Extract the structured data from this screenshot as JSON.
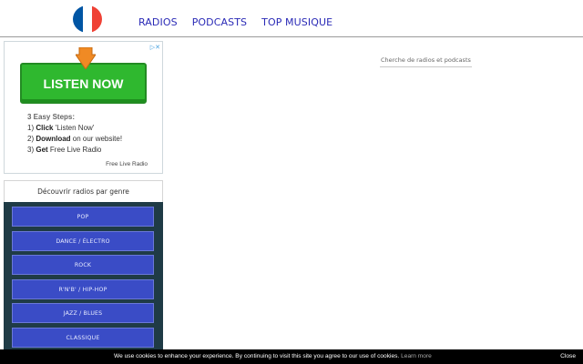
{
  "header": {
    "flag_colors": [
      "#0055a4",
      "#ffffff",
      "#ef4135"
    ],
    "nav": [
      "RADIOS",
      "PODCASTS",
      "TOP MUSIQUE"
    ],
    "link_color": "#2a2ab6"
  },
  "search": {
    "placeholder": "Cherche de radios et podcasts"
  },
  "ad": {
    "close_glyphs": "▷✕",
    "button_label": "LISTEN NOW",
    "steps_title": "3 Easy Steps:",
    "steps": [
      {
        "prefix": "1) ",
        "bold": "Click",
        "rest": " 'Listen Now'"
      },
      {
        "prefix": "2) ",
        "bold": "Download",
        "rest": " on our website!"
      },
      {
        "prefix": "3) ",
        "bold": "Get",
        "rest": " Free Live Radio"
      }
    ],
    "footer": "Free Live Radio",
    "button_color": "#2fb82f",
    "arrow_color": "#f08a24"
  },
  "genres": {
    "title": "Découvrir radios par genre",
    "items": [
      "POP",
      "DANCE / ÉLECTRO",
      "ROCK",
      "R'N'B' / HIP-HOP",
      "JAZZ / BLUES",
      "CLASSIQUE"
    ],
    "panel_color": "#1f3b46",
    "button_color": "#3a4cc6"
  },
  "cookie": {
    "text": "We use cookies to enhance your experience. By continuing to visit this site you agree to our use of cookies.",
    "link": "Learn more",
    "close": "Close"
  }
}
